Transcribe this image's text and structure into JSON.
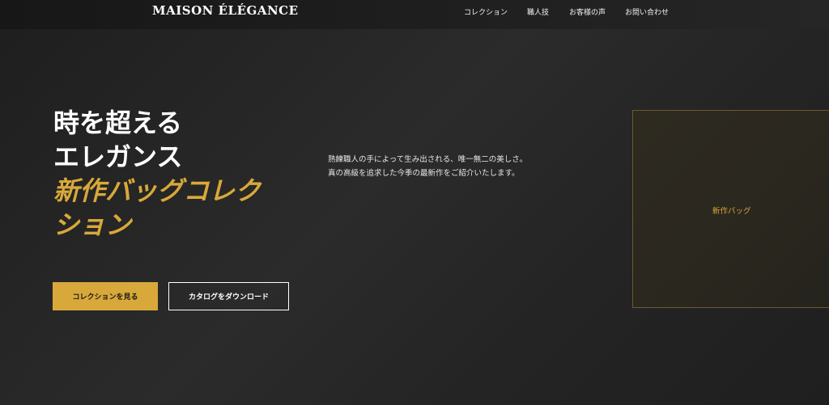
{
  "brand": {
    "logo": "MAISON ÉLÉGANCE"
  },
  "nav": {
    "items": [
      {
        "label": "コレクション"
      },
      {
        "label": "職人技"
      },
      {
        "label": "お客様の声"
      },
      {
        "label": "お問い合わせ"
      }
    ]
  },
  "hero": {
    "title_lines": [
      "時を超える",
      "エレガンス"
    ],
    "highlight_lines": [
      "新作バッグコレク",
      "ション"
    ],
    "description_lines": [
      "熟練職人の手によって生み出される、唯一無二の美しさ。",
      "真の高級を追求した今季の最新作をご紹介いたします。"
    ],
    "primary_button": "コレクションを見る",
    "secondary_button": "カタログをダウンロード"
  },
  "product": {
    "label": "新作バッグ"
  },
  "colors": {
    "accent": "#d8a93a",
    "background": "#1e1e1e",
    "text": "#ffffff"
  }
}
